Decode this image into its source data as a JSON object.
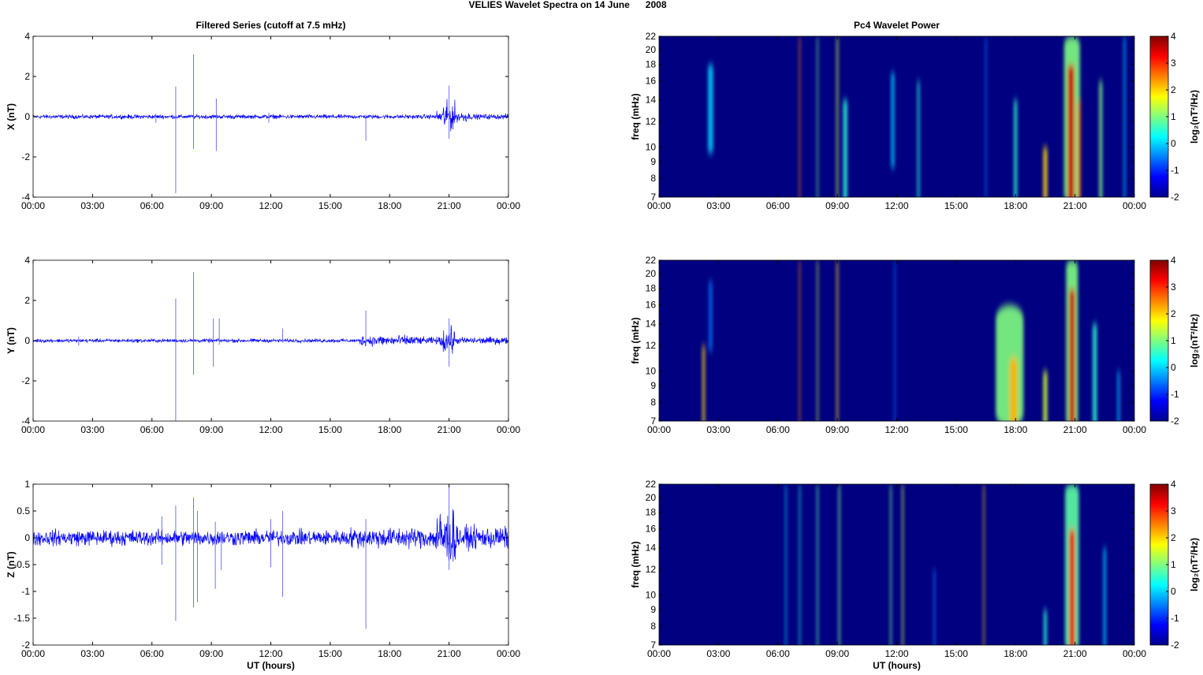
{
  "figure_title": "VELIES Wavelet Spectra on 14 June      2008",
  "colors": {
    "trace": "#0000ff",
    "spike": "#7070ff",
    "background_power": "#00008f"
  },
  "chart_data": [
    {
      "type": "line",
      "title": "Filtered Series (cutoff at 7.5 mHz)",
      "ylabel": "X (nT)",
      "xlabel": "",
      "xlim": [
        0,
        24
      ],
      "ylim": [
        -4,
        4
      ],
      "yticks": [
        "4",
        "2",
        "0",
        "-2",
        "-4"
      ],
      "ytick_values": [
        4,
        2,
        0,
        -2,
        -4
      ],
      "xticks": [
        "00:00",
        "03:00",
        "06:00",
        "09:00",
        "12:00",
        "15:00",
        "18:00",
        "21:00",
        "00:00"
      ],
      "noise_envelope": [
        [
          0,
          20.3,
          0.07
        ],
        [
          20.3,
          20.7,
          0.2
        ],
        [
          20.7,
          21.3,
          0.5
        ],
        [
          21.3,
          22,
          0.18
        ],
        [
          22,
          24,
          0.09
        ]
      ],
      "spikes": [
        [
          6.2,
          0.15,
          -0.3
        ],
        [
          7.2,
          1.5,
          -3.8
        ],
        [
          8.1,
          3.1,
          -1.6
        ],
        [
          9.25,
          0.9,
          -1.7
        ],
        [
          11.9,
          0.2,
          -0.3
        ],
        [
          16.8,
          0.1,
          -1.2
        ],
        [
          21.0,
          1.55,
          -1.1
        ]
      ]
    },
    {
      "type": "line",
      "title": "",
      "ylabel": "Y (nT)",
      "xlabel": "",
      "xlim": [
        0,
        24
      ],
      "ylim": [
        -4,
        4
      ],
      "yticks": [
        "4",
        "2",
        "0",
        "-2",
        "-4"
      ],
      "ytick_values": [
        4,
        2,
        0,
        -2,
        -4
      ],
      "xticks": [
        "00:00",
        "03:00",
        "06:00",
        "09:00",
        "12:00",
        "15:00",
        "18:00",
        "21:00",
        "00:00"
      ],
      "noise_envelope": [
        [
          0,
          16.5,
          0.06
        ],
        [
          16.5,
          19.5,
          0.18
        ],
        [
          19.5,
          20.6,
          0.12
        ],
        [
          20.6,
          21.3,
          0.45
        ],
        [
          21.3,
          24,
          0.12
        ]
      ],
      "spikes": [
        [
          2.3,
          0.2,
          -0.25
        ],
        [
          7.2,
          2.1,
          -4.0
        ],
        [
          8.1,
          3.4,
          -1.7
        ],
        [
          9.1,
          1.1,
          -1.3
        ],
        [
          9.4,
          1.1,
          -0.2
        ],
        [
          12.6,
          0.6,
          -0.1
        ],
        [
          16.8,
          1.5,
          -0.2
        ],
        [
          21.0,
          1.1,
          -1.3
        ]
      ]
    },
    {
      "type": "line",
      "title": "",
      "ylabel": "Z (nT)",
      "xlabel": "UT (hours)",
      "xlim": [
        0,
        24
      ],
      "ylim": [
        -2,
        1
      ],
      "yticks": [
        "1",
        "0.5",
        "0",
        "-0.5",
        "-1",
        "-1.5",
        "-2"
      ],
      "ytick_values": [
        1,
        0.5,
        0,
        -0.5,
        -1,
        -1.5,
        -2
      ],
      "xticks": [
        "00:00",
        "03:00",
        "06:00",
        "09:00",
        "12:00",
        "15:00",
        "18:00",
        "21:00",
        "00:00"
      ],
      "noise_envelope": [
        [
          0,
          16,
          0.1
        ],
        [
          16,
          20.3,
          0.13
        ],
        [
          20.3,
          21.4,
          0.35
        ],
        [
          21.4,
          24,
          0.14
        ]
      ],
      "spikes": [
        [
          6.5,
          0.4,
          -0.5
        ],
        [
          7.2,
          0.6,
          -1.55
        ],
        [
          8.1,
          0.75,
          -1.3
        ],
        [
          8.3,
          0.5,
          -1.2
        ],
        [
          9.2,
          0.3,
          -0.95
        ],
        [
          9.5,
          0.1,
          -0.6
        ],
        [
          12.0,
          0.35,
          -0.55
        ],
        [
          12.6,
          0.5,
          -1.1
        ],
        [
          16.8,
          0.35,
          -1.7
        ],
        [
          21.0,
          0.95,
          -0.6
        ]
      ]
    },
    {
      "type": "heatmap",
      "title": "Pc4 Wavelet Power",
      "ylabel": "freq (mHz)",
      "xlabel": "",
      "xlim": [
        0,
        24
      ],
      "ylim": [
        7,
        22
      ],
      "yscale": "log",
      "yticks": [
        "22",
        "20",
        "18",
        "16",
        "14",
        "12",
        "10",
        "9",
        "8",
        "7"
      ],
      "ytick_values": [
        22,
        20,
        18,
        16,
        14,
        12,
        10,
        9,
        8,
        7
      ],
      "xticks": [
        "00:00",
        "03:00",
        "06:00",
        "09:00",
        "12:00",
        "15:00",
        "18:00",
        "21:00",
        "00:00"
      ],
      "colorbar": {
        "label": "log₂(nT²/Hz)",
        "range": [
          -2,
          4
        ],
        "ticks": [
          "4",
          "3",
          "2",
          "1",
          "0",
          "-1",
          "-2"
        ],
        "tick_values": [
          4,
          3,
          2,
          1,
          0,
          -1,
          -2
        ]
      },
      "features": [
        {
          "t": 2.6,
          "w": 0.25,
          "fmin": 10,
          "fmax": 18,
          "p": 0
        },
        {
          "t": 7.1,
          "w": 0.05,
          "fmin": 7,
          "fmax": 22,
          "p": 2.5
        },
        {
          "t": 8.0,
          "w": 0.06,
          "fmin": 7,
          "fmax": 22,
          "p": 1
        },
        {
          "t": 9.0,
          "w": 0.08,
          "fmin": 7,
          "fmax": 22,
          "p": 1.5
        },
        {
          "t": 9.4,
          "w": 0.2,
          "fmin": 7,
          "fmax": 14,
          "p": 0.5
        },
        {
          "t": 11.8,
          "w": 0.15,
          "fmin": 9,
          "fmax": 17,
          "p": 0
        },
        {
          "t": 13.1,
          "w": 0.1,
          "fmin": 7,
          "fmax": 16,
          "p": 0.5
        },
        {
          "t": 16.5,
          "w": 0.05,
          "fmin": 7,
          "fmax": 22,
          "p": -0.5
        },
        {
          "t": 18.0,
          "w": 0.15,
          "fmin": 7,
          "fmax": 14,
          "p": 0.5
        },
        {
          "t": 19.5,
          "w": 0.2,
          "fmin": 7,
          "fmax": 10,
          "p": 2
        },
        {
          "t": 20.85,
          "w": 0.8,
          "fmin": 7,
          "fmax": 22,
          "p": 1
        },
        {
          "t": 20.8,
          "w": 0.35,
          "fmin": 7,
          "fmax": 18,
          "p": 3.5
        },
        {
          "t": 21.2,
          "w": 0.15,
          "fmin": 7,
          "fmax": 14,
          "p": 2.5
        },
        {
          "t": 22.3,
          "w": 0.15,
          "fmin": 7,
          "fmax": 16,
          "p": 1
        },
        {
          "t": 23.5,
          "w": 0.08,
          "fmin": 7,
          "fmax": 22,
          "p": 0
        }
      ]
    },
    {
      "type": "heatmap",
      "title": "",
      "ylabel": "freq (mHz)",
      "xlabel": "",
      "xlim": [
        0,
        24
      ],
      "ylim": [
        7,
        22
      ],
      "yscale": "log",
      "yticks": [
        "22",
        "20",
        "18",
        "16",
        "14",
        "12",
        "10",
        "9",
        "8",
        "7"
      ],
      "ytick_values": [
        22,
        20,
        18,
        16,
        14,
        12,
        10,
        9,
        8,
        7
      ],
      "xticks": [
        "00:00",
        "03:00",
        "06:00",
        "09:00",
        "12:00",
        "15:00",
        "18:00",
        "21:00",
        "00:00"
      ],
      "colorbar": {
        "label": "log₂(nT²/Hz)",
        "range": [
          -2,
          4
        ],
        "ticks": [
          "4",
          "3",
          "2",
          "1",
          "0",
          "-1",
          "-2"
        ],
        "tick_values": [
          4,
          3,
          2,
          1,
          0,
          -1,
          -2
        ]
      },
      "features": [
        {
          "t": 2.25,
          "w": 0.12,
          "fmin": 7,
          "fmax": 12,
          "p": 2
        },
        {
          "t": 2.6,
          "w": 0.15,
          "fmin": 12,
          "fmax": 19,
          "p": -0.5
        },
        {
          "t": 7.1,
          "w": 0.05,
          "fmin": 7,
          "fmax": 22,
          "p": 2.5
        },
        {
          "t": 8.0,
          "w": 0.06,
          "fmin": 7,
          "fmax": 22,
          "p": 1.5
        },
        {
          "t": 9.0,
          "w": 0.08,
          "fmin": 7,
          "fmax": 22,
          "p": 2
        },
        {
          "t": 11.9,
          "w": 0.05,
          "fmin": 7,
          "fmax": 22,
          "p": -0.5
        },
        {
          "t": 17.7,
          "w": 1.4,
          "fmin": 7,
          "fmax": 16,
          "p": 1
        },
        {
          "t": 17.9,
          "w": 0.4,
          "fmin": 7,
          "fmax": 11,
          "p": 2.2
        },
        {
          "t": 19.5,
          "w": 0.2,
          "fmin": 7,
          "fmax": 10,
          "p": 1.5
        },
        {
          "t": 20.85,
          "w": 0.6,
          "fmin": 7,
          "fmax": 22,
          "p": 1
        },
        {
          "t": 20.85,
          "w": 0.3,
          "fmin": 7,
          "fmax": 18,
          "p": 3.5
        },
        {
          "t": 22.0,
          "w": 0.2,
          "fmin": 7,
          "fmax": 14,
          "p": 0.5
        },
        {
          "t": 23.2,
          "w": 0.1,
          "fmin": 7,
          "fmax": 10,
          "p": 0
        }
      ]
    },
    {
      "type": "heatmap",
      "title": "",
      "ylabel": "freq (mHz)",
      "xlabel": "UT (hours)",
      "xlim": [
        0,
        24
      ],
      "ylim": [
        7,
        22
      ],
      "yscale": "log",
      "yticks": [
        "22",
        "20",
        "18",
        "16",
        "14",
        "12",
        "10",
        "9",
        "8",
        "7"
      ],
      "ytick_values": [
        22,
        20,
        18,
        16,
        14,
        12,
        10,
        9,
        8,
        7
      ],
      "xticks": [
        "00:00",
        "03:00",
        "06:00",
        "09:00",
        "12:00",
        "15:00",
        "18:00",
        "21:00",
        "00:00"
      ],
      "colorbar": {
        "label": "log₂(nT²/Hz)",
        "range": [
          -2,
          4
        ],
        "ticks": [
          "4",
          "3",
          "2",
          "1",
          "0",
          "-1",
          "-2"
        ],
        "tick_values": [
          4,
          3,
          2,
          1,
          0,
          -1,
          -2
        ]
      },
      "features": [
        {
          "t": 6.4,
          "w": 0.06,
          "fmin": 7,
          "fmax": 22,
          "p": 0
        },
        {
          "t": 7.1,
          "w": 0.05,
          "fmin": 7,
          "fmax": 22,
          "p": 0.5
        },
        {
          "t": 8.0,
          "w": 0.07,
          "fmin": 7,
          "fmax": 22,
          "p": 0.8
        },
        {
          "t": 9.1,
          "w": 0.08,
          "fmin": 7,
          "fmax": 22,
          "p": 1
        },
        {
          "t": 11.7,
          "w": 0.07,
          "fmin": 7,
          "fmax": 22,
          "p": 1
        },
        {
          "t": 12.3,
          "w": 0.07,
          "fmin": 7,
          "fmax": 22,
          "p": 1.5
        },
        {
          "t": 13.9,
          "w": 0.08,
          "fmin": 7,
          "fmax": 12,
          "p": -0.5
        },
        {
          "t": 16.4,
          "w": 0.05,
          "fmin": 7,
          "fmax": 22,
          "p": 2
        },
        {
          "t": 19.5,
          "w": 0.15,
          "fmin": 7,
          "fmax": 9,
          "p": 0.5
        },
        {
          "t": 20.85,
          "w": 0.7,
          "fmin": 7,
          "fmax": 22,
          "p": 0.8
        },
        {
          "t": 20.85,
          "w": 0.3,
          "fmin": 7,
          "fmax": 16,
          "p": 3.3
        },
        {
          "t": 22.5,
          "w": 0.12,
          "fmin": 7,
          "fmax": 14,
          "p": 0
        }
      ]
    }
  ]
}
